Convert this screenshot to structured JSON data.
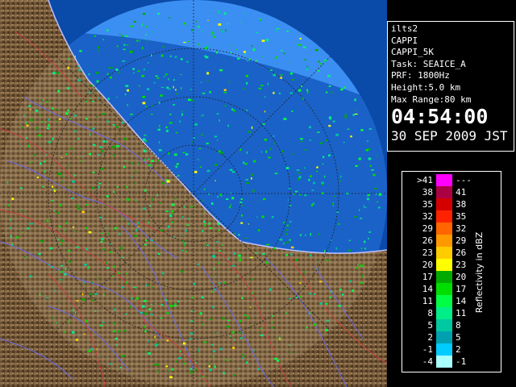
{
  "info": {
    "station": "ilts2",
    "product": "CAPPI",
    "product_code": "CAPPI_5K",
    "task": "Task: SEAICE_A",
    "prf": "PRF: 1800Hz",
    "height": "Height:5.0 km",
    "max_range": "Max Range:80 km",
    "time": "04:54:00",
    "date": "30 SEP 2009 JST"
  },
  "legend": {
    "title": "Reflectivity in dBZ",
    "rows": [
      {
        "lo": ">41",
        "hi": "---",
        "color": "#ff00ff"
      },
      {
        "lo": "38",
        "hi": "41",
        "color": "#aa0044"
      },
      {
        "lo": "35",
        "hi": "38",
        "color": "#d40000"
      },
      {
        "lo": "32",
        "hi": "35",
        "color": "#ff2200"
      },
      {
        "lo": "29",
        "hi": "32",
        "color": "#ff6600"
      },
      {
        "lo": "26",
        "hi": "29",
        "color": "#ff9900"
      },
      {
        "lo": "23",
        "hi": "26",
        "color": "#ffcc00"
      },
      {
        "lo": "20",
        "hi": "23",
        "color": "#ffff00"
      },
      {
        "lo": "17",
        "hi": "20",
        "color": "#00aa00"
      },
      {
        "lo": "14",
        "hi": "17",
        "color": "#00dd00"
      },
      {
        "lo": "11",
        "hi": "14",
        "color": "#00ff44"
      },
      {
        "lo": "8",
        "hi": "11",
        "color": "#00ee88"
      },
      {
        "lo": "5",
        "hi": "8",
        "color": "#00c8a0"
      },
      {
        "lo": "2",
        "hi": "5",
        "color": "#00a0b0"
      },
      {
        "lo": "-1",
        "hi": "2",
        "color": "#00ccff"
      },
      {
        "lo": "-4",
        "hi": "-1",
        "color": "#aaffff"
      }
    ]
  },
  "colors": {
    "sea": "#1a62c8",
    "range_circle": "#3c8ff2",
    "land": "#7a5c3a",
    "rivers": "#6a6aff",
    "borders": "#d04040"
  }
}
